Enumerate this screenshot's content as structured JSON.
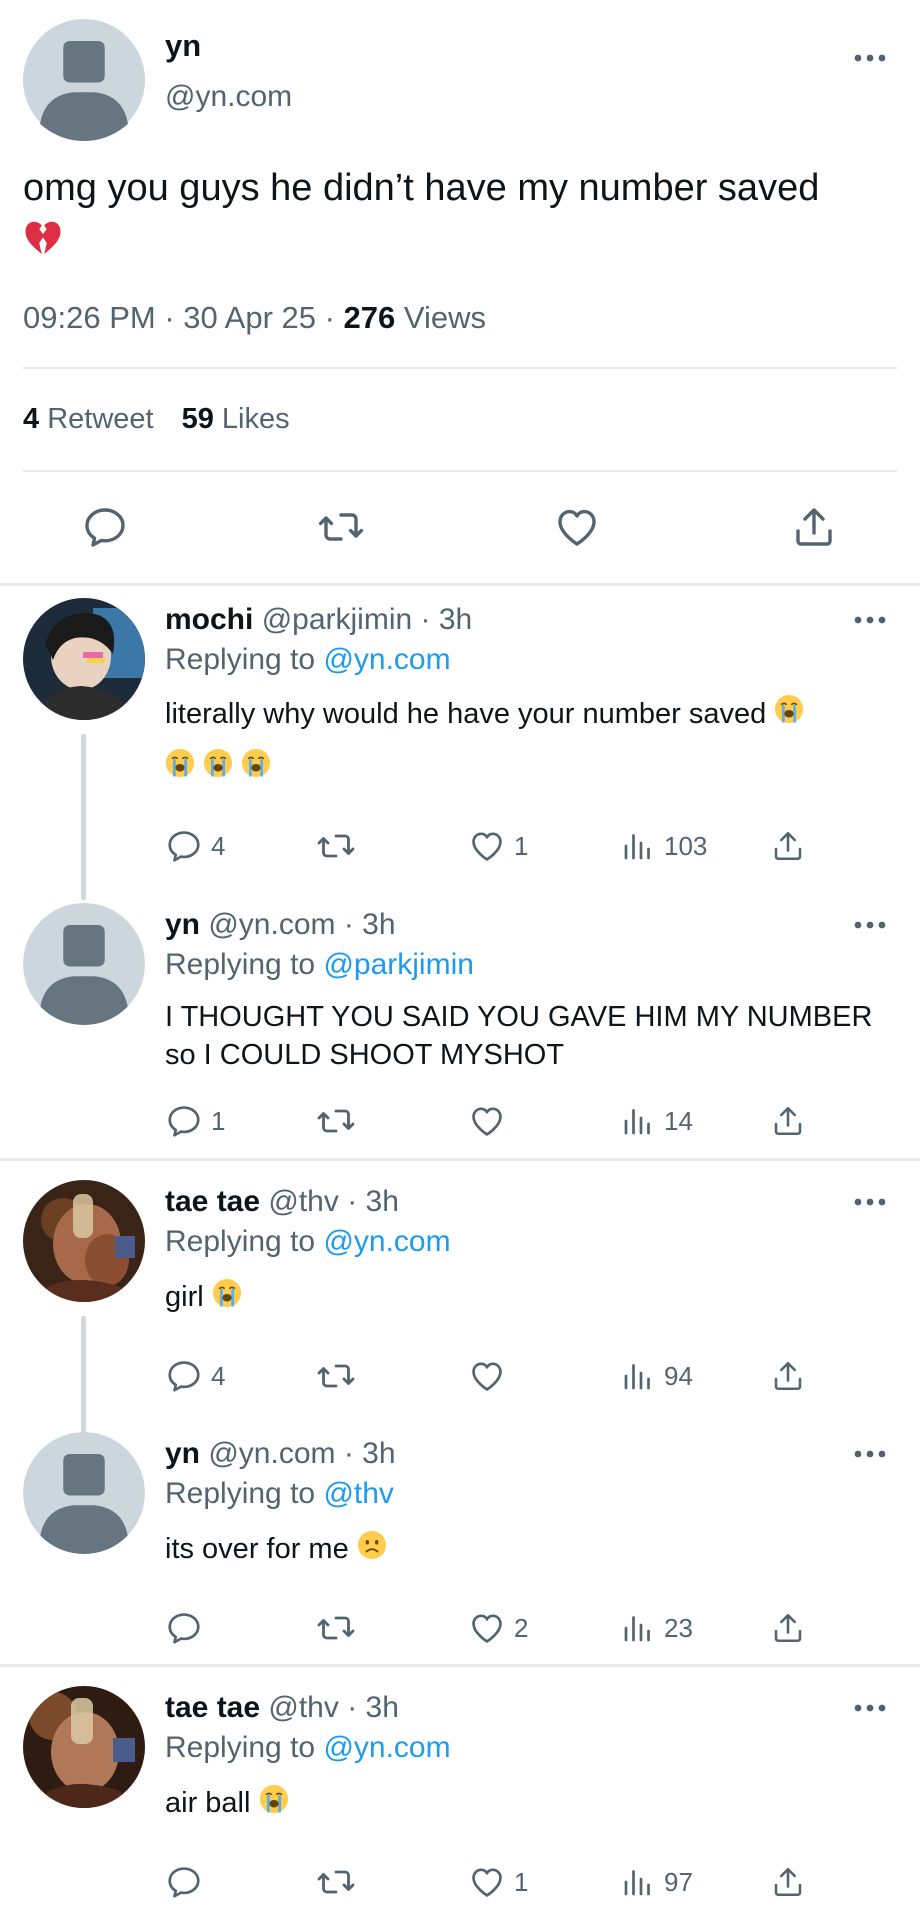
{
  "main_tweet": {
    "name": "yn",
    "handle": "@yn.com",
    "text": "omg you guys he didn’t have my number saved",
    "emoji": "broken-heart-emoji",
    "time": "09:26 PM",
    "sep1": " · ",
    "date": "30 Apr 25",
    "sep2": " · ",
    "views_count": "276",
    "views_label": " Views",
    "retweet_count": "4",
    "retweet_label": " Retweet",
    "likes_count": "59",
    "likes_label": " Likes",
    "actions": [
      "reply-icon",
      "retweet-icon",
      "like-icon",
      "share-icon"
    ]
  },
  "replies": [
    {
      "name": "mochi",
      "handle": " @parkjimin · 3h",
      "replying_label": "Replying to ",
      "replying_to": "@yn.com",
      "text": "literally why would he have your number saved",
      "emoji_count": 4,
      "reply_count": "4",
      "retweet_count": "",
      "like_count": "1",
      "view_count": "103"
    },
    {
      "name": "yn",
      "handle": " @yn.com · 3h",
      "replying_label": "Replying to ",
      "replying_to": "@parkjimin",
      "text": "I THOUGHT YOU SAID YOU GAVE HIM MY NUMBER so I COULD SHOOT MYSHOT",
      "emoji_count": 0,
      "reply_count": "1",
      "retweet_count": "",
      "like_count": "",
      "view_count": "14"
    },
    {
      "name": "tae tae",
      "handle": " @thv · 3h",
      "replying_label": "Replying to ",
      "replying_to": "@yn.com",
      "text": "girl",
      "emoji_count": 1,
      "reply_count": "4",
      "retweet_count": "",
      "like_count": "",
      "view_count": "94"
    },
    {
      "name": "yn",
      "handle": " @yn.com · 3h",
      "replying_label": "Replying to ",
      "replying_to": "@thv",
      "text": "its over for me",
      "emoji_count": 1,
      "reply_count": "",
      "retweet_count": "",
      "like_count": "2",
      "view_count": "23"
    },
    {
      "name": "tae tae",
      "handle": " @thv · 3h",
      "replying_label": "Replying to ",
      "replying_to": "@yn.com",
      "text": "air ball",
      "emoji_count": 1,
      "reply_count": "",
      "retweet_count": "",
      "like_count": "1",
      "view_count": "97"
    }
  ],
  "colors": {
    "text": "#0f1419",
    "secondary": "#536471",
    "link": "#1d9bf0",
    "divider": "#e7e9ea",
    "avatar_bg": "#ccd6dd",
    "avatar_fg": "#66757f"
  }
}
